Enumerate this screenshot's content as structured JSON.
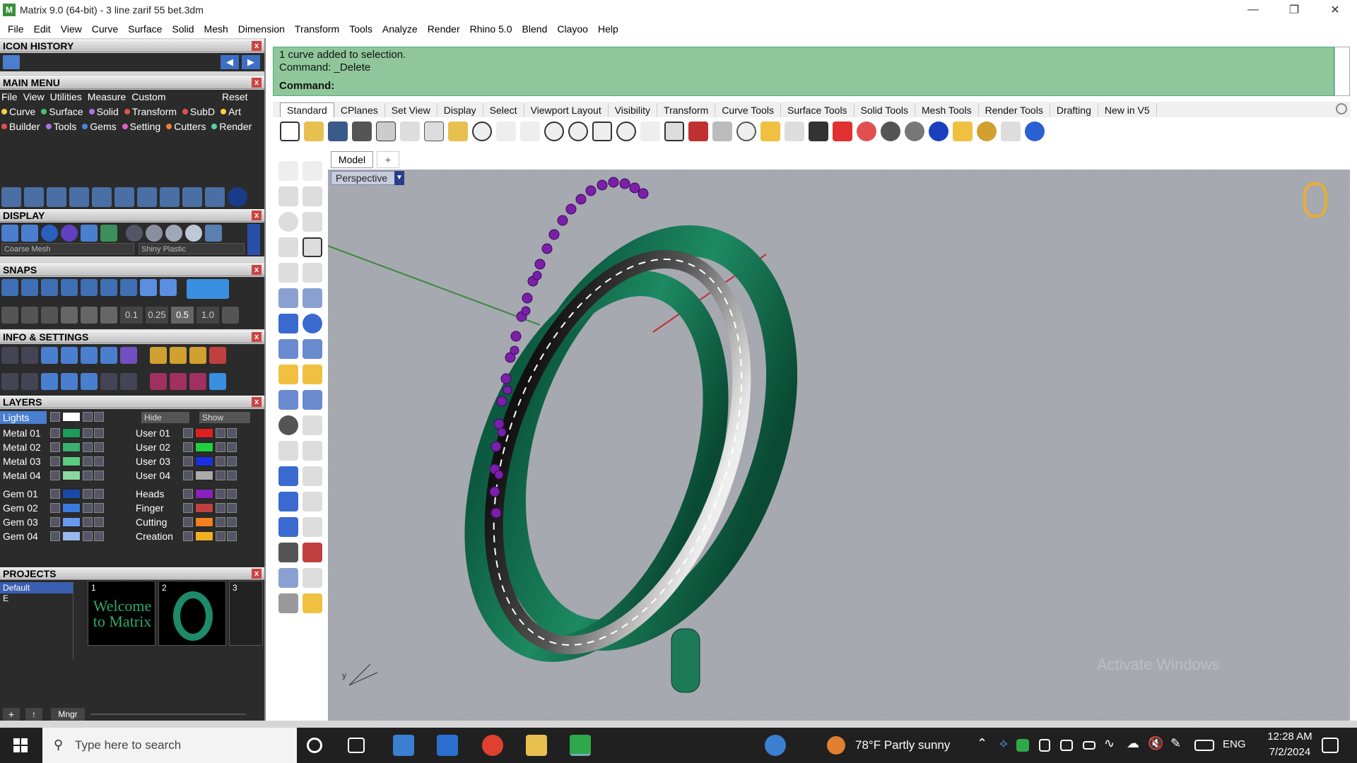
{
  "window": {
    "title": "Matrix 9.0 (64-bit) - 3 line zarif 55 bet.3dm",
    "icon_letter": "M"
  },
  "menubar": [
    "File",
    "Edit",
    "View",
    "Curve",
    "Surface",
    "Solid",
    "Mesh",
    "Dimension",
    "Transform",
    "Tools",
    "Analyze",
    "Render",
    "Rhino 5.0",
    "Blend",
    "Clayoo",
    "Help"
  ],
  "left": {
    "icon_history": "ICON HISTORY",
    "main_menu": "MAIN MENU",
    "main_menu_items": [
      "File",
      "View",
      "Utilities",
      "Measure",
      "Custom"
    ],
    "reset": "Reset",
    "row1": [
      "Curve",
      "Surface",
      "Solid",
      "Transform",
      "SubD",
      "Art"
    ],
    "row2": [
      "Builder",
      "Tools",
      "Gems",
      "Setting",
      "Cutters",
      "Render"
    ],
    "display": "DISPLAY",
    "coarse_mesh": "Coarse Mesh",
    "shiny_plastic": "Shiny Plastic",
    "snaps": "SNAPS",
    "snap_values": [
      "0.1",
      "0.25",
      "0.5",
      "1.0"
    ],
    "info_settings": "INFO & SETTINGS",
    "layers": "LAYERS",
    "lights": "Lights",
    "hide": "Hide",
    "show": "Show",
    "layers_left": [
      "Metal 01",
      "Metal 02",
      "Metal 03",
      "Metal 04",
      "Gem 01",
      "Gem 02",
      "Gem 03",
      "Gem 04"
    ],
    "layers_right": [
      "User 01",
      "User 02",
      "User 03",
      "User 04",
      "Heads",
      "Finger",
      "Cutting",
      "Creation"
    ],
    "projects": "PROJECTS",
    "project_default": "Default",
    "project_e": "E",
    "proj1_num": "1",
    "proj2_num": "2",
    "proj3_num": "3",
    "welcome": "Welcome to Matrix",
    "mngr": "Mngr"
  },
  "command": {
    "line1": "1 curve added to selection.",
    "line2": "Command: _Delete",
    "prompt": "Command:"
  },
  "tabs": [
    "Standard",
    "CPlanes",
    "Set View",
    "Display",
    "Select",
    "Viewport Layout",
    "Visibility",
    "Transform",
    "Curve Tools",
    "Surface Tools",
    "Solid Tools",
    "Mesh Tools",
    "Render Tools",
    "Drafting",
    "New in V5"
  ],
  "viewport": {
    "model_tab": "Model",
    "plus": "+",
    "label": "Perspective",
    "watermark": "Activate Windows"
  },
  "taskbar": {
    "search_placeholder": "Type here to search",
    "weather": "78°F  Partly sunny",
    "lang": "ENG",
    "time": "12:28 AM",
    "date": "7/2/2024"
  }
}
